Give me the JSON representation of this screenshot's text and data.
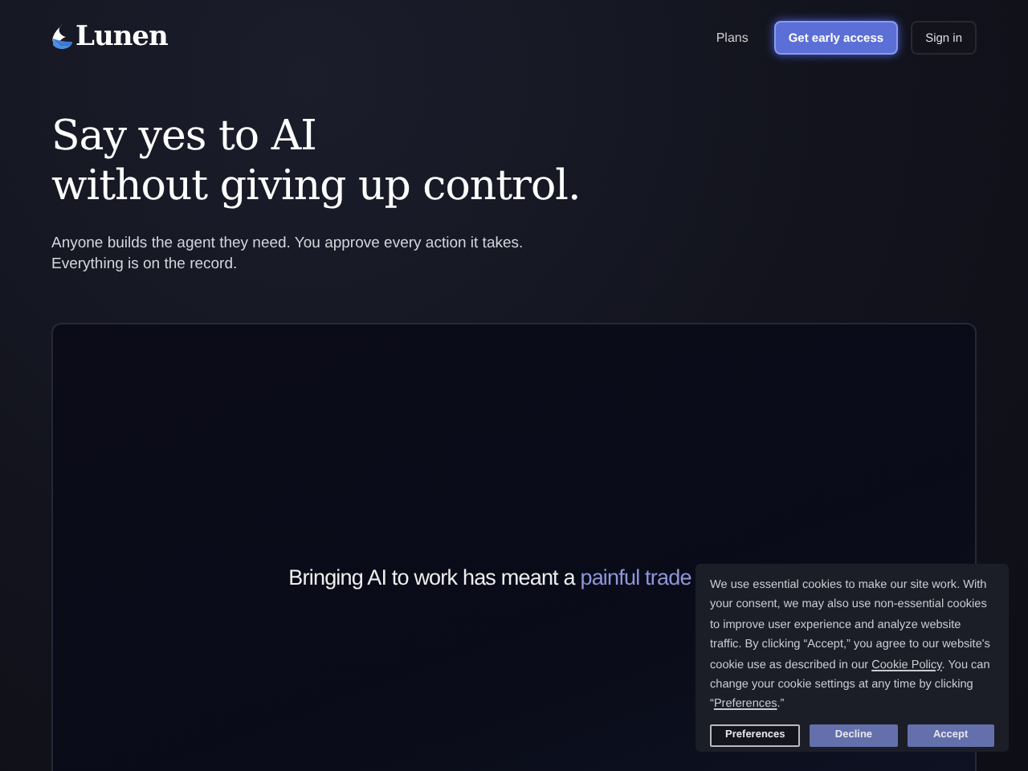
{
  "nav": {
    "logo": "Lunen",
    "links": [
      "Plans"
    ],
    "primary_button": "Get early access",
    "secondary_button": "Sign in"
  },
  "hero": {
    "title_lines": [
      "Say yes to AI",
      "without giving up control."
    ],
    "subtitle_lines": [
      "Anyone builds the agent they need. You approve every action it takes.",
      "Everything is on the record."
    ]
  },
  "panel": {
    "lead": "Bringing AI to work has meant a",
    "highlight": "painful trade"
  },
  "cookie_banner": {
    "parts": [
      {
        "kind": "text",
        "text": "We use essential cookies to make our site work. With your consent, we may also use non-essential cookies to improve user experience and analyze website traffic. By clicking “Accept,” you agree to our website's cookie use as described in our "
      },
      {
        "kind": "link",
        "text": "Cookie Policy"
      },
      {
        "kind": "text",
        "text": ". You can change your cookie settings at any time by clicking “"
      },
      {
        "kind": "link",
        "text": "Preferences"
      },
      {
        "kind": "text",
        "text": ".”"
      }
    ],
    "buttons": [
      {
        "label": "Preferences",
        "kind": "outline"
      },
      {
        "label": "Decline",
        "kind": "filled"
      },
      {
        "label": "Accept",
        "kind": "filled"
      }
    ]
  }
}
